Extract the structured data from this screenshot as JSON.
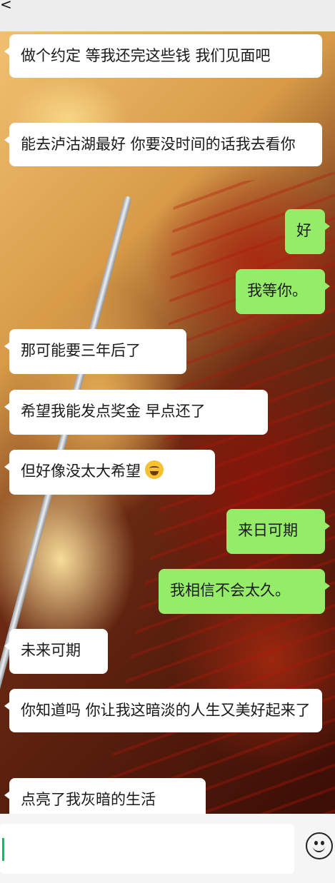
{
  "header": {
    "back_glyph": "<"
  },
  "messages": [
    {
      "side": "in",
      "text": "做个约定 等我还完这些钱 我们见面吧"
    },
    {
      "side": "in",
      "text": "能去泸沽湖最好 你要没时间的话我去看你"
    },
    {
      "side": "out",
      "text": "好"
    },
    {
      "side": "out",
      "text": "我等你。"
    },
    {
      "side": "in",
      "text": "那可能要三年后了"
    },
    {
      "side": "in",
      "text": "希望我能发点奖金 早点还了"
    },
    {
      "side": "in",
      "text": "但好像没太大希望"
    },
    {
      "side": "out",
      "text": "来日可期"
    },
    {
      "side": "out",
      "text": "我相信不会太久。"
    },
    {
      "side": "in",
      "text": "未来可期"
    },
    {
      "side": "in",
      "text": "你知道吗 你让我这暗淡的人生又美好起来了"
    },
    {
      "side": "in",
      "text": "点亮了我灰暗的生活"
    }
  ],
  "emoji": {
    "message_7": "laughing-tears-emoji"
  },
  "composer": {
    "value": "",
    "emoji_button": "smile-icon"
  },
  "colors": {
    "incoming": "#ffffff",
    "outgoing": "#95ec69",
    "accent": "#07c160"
  }
}
